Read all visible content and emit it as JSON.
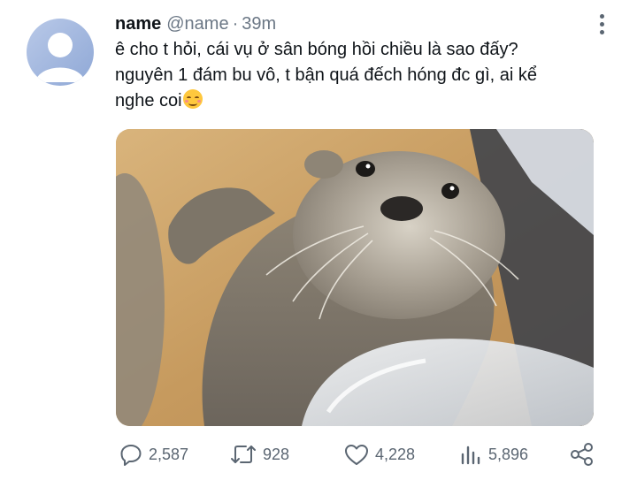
{
  "author": {
    "display_name": "name",
    "handle": "@name",
    "separator": "·",
    "time": "39m"
  },
  "tweet": {
    "lines": [
      "ê cho t hỏi, cái vụ ở sân bóng hồi chiều là sao đấy?",
      "nguyên 1 đám bu vô, t bận quá đếch hóng đc gì, ai kể",
      "nghe coi"
    ],
    "emoji": "smiling-face-with-blush-emoji"
  },
  "media": {
    "icon": "otter-photo"
  },
  "actions": {
    "replies": "2,587",
    "retweets": "928",
    "likes": "4,228",
    "views": "5,896"
  },
  "colors": {
    "text": "#0f1419",
    "secondary": "#5b6672",
    "avatar": "#9db2dc"
  }
}
